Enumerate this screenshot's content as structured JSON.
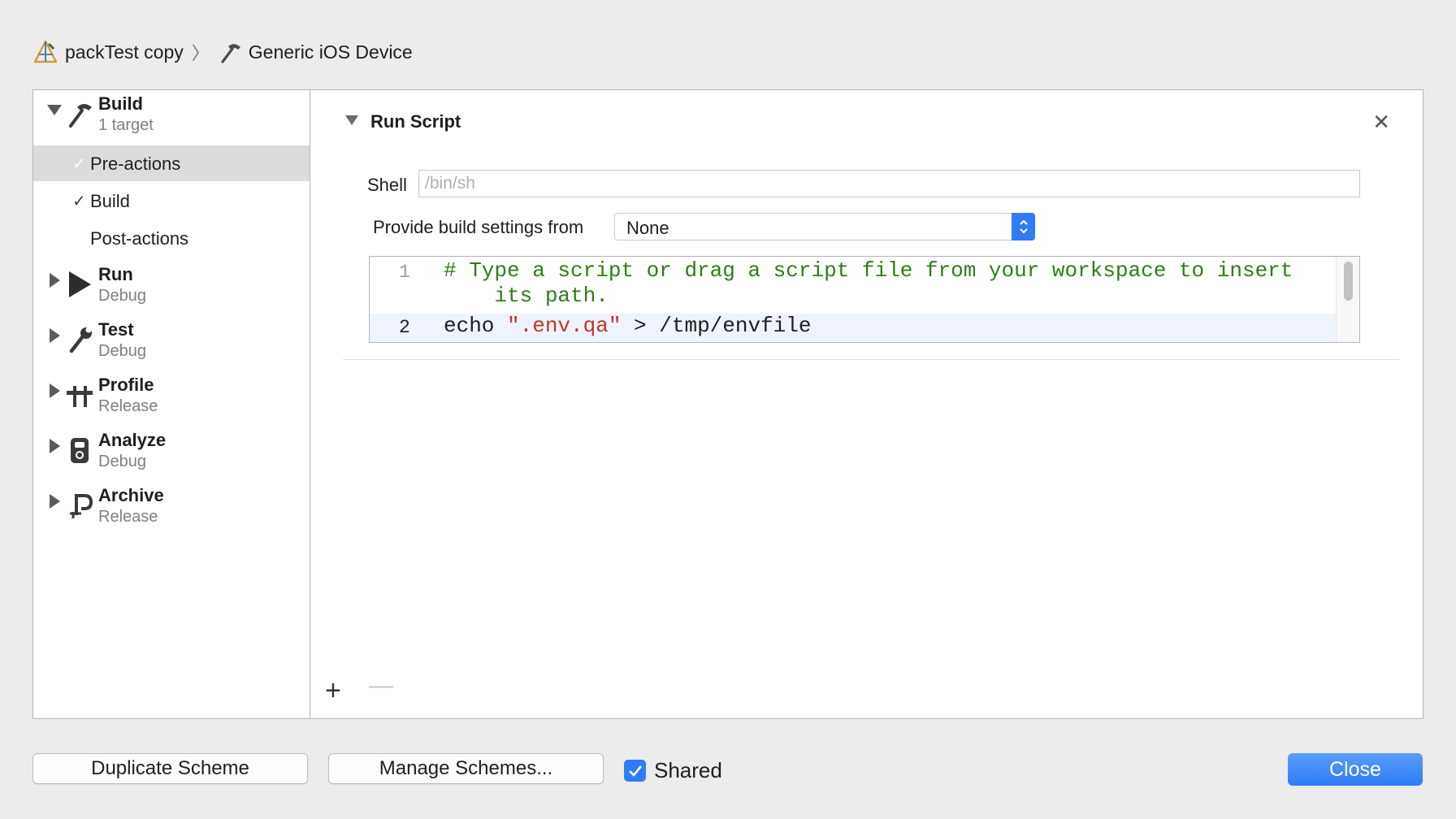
{
  "breadcrumb": {
    "project": "packTest copy",
    "separator": "〉",
    "device": "Generic iOS Device"
  },
  "sidebar": {
    "phases": [
      {
        "title": "Build",
        "subtitle": "1 target",
        "expanded": true
      },
      {
        "title": "Run",
        "subtitle": "Debug"
      },
      {
        "title": "Test",
        "subtitle": "Debug"
      },
      {
        "title": "Profile",
        "subtitle": "Release"
      },
      {
        "title": "Analyze",
        "subtitle": "Debug"
      },
      {
        "title": "Archive",
        "subtitle": "Release"
      }
    ],
    "build_items": [
      {
        "label": "Pre-actions",
        "check": "✓",
        "selected": true
      },
      {
        "label": "Build",
        "check": "✓"
      },
      {
        "label": "Post-actions",
        "check": ""
      }
    ]
  },
  "run_script": {
    "title": "Run Script",
    "close_glyph": "✕",
    "shell_label": "Shell",
    "shell_placeholder": "/bin/sh",
    "build_settings_label": "Provide build settings from",
    "build_settings_value": "None",
    "editor": {
      "line_numbers": [
        "1",
        "2"
      ],
      "line1_a": "# Type a script or drag a script file from your workspace to insert",
      "line1_b": "    its path.",
      "line2_cmd": "echo ",
      "line2_str": "\".env.qa\"",
      "line2_rest": " > /tmp/envfile"
    },
    "add_glyph": "+",
    "remove_glyph": "—"
  },
  "footer": {
    "duplicate": "Duplicate Scheme",
    "manage": "Manage Schemes...",
    "shared_label": "Shared",
    "shared_checked": true,
    "close": "Close"
  },
  "colors": {
    "accent": "#2f7cf6",
    "comment": "#2e7d18",
    "string": "#c0352b"
  }
}
